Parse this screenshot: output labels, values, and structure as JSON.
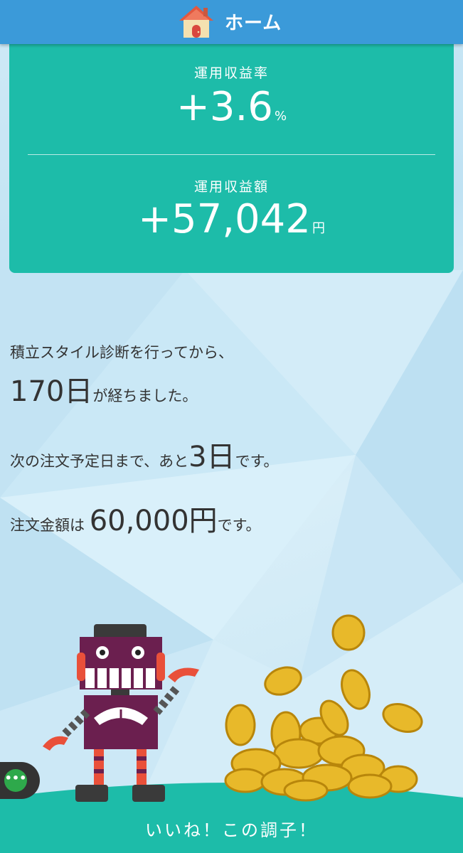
{
  "header": {
    "title": "ホーム",
    "icon": "house-icon",
    "color": "#3b9ad9"
  },
  "card": {
    "color": "#1dbca9",
    "rate_label": "運用収益率",
    "rate_value": "+3.6",
    "rate_unit": "%",
    "amount_label": "運用収益額",
    "amount_value": "+57,042",
    "amount_unit": "円"
  },
  "info": {
    "line1": "積立スタイル診断を行ってから、",
    "days_value": "170日",
    "days_suffix": "が経ちました。",
    "next_prefix": "次の注文予定日まで、あと",
    "next_value": "3日",
    "next_suffix": "です。",
    "order_prefix": "注文金額は",
    "order_value": "60,000円",
    "order_suffix": "です。"
  },
  "footer": {
    "message": "いいね！この調子！",
    "color": "#1dbca9"
  },
  "chat_button": {
    "icon": "more-dots-icon",
    "label": "•••"
  }
}
